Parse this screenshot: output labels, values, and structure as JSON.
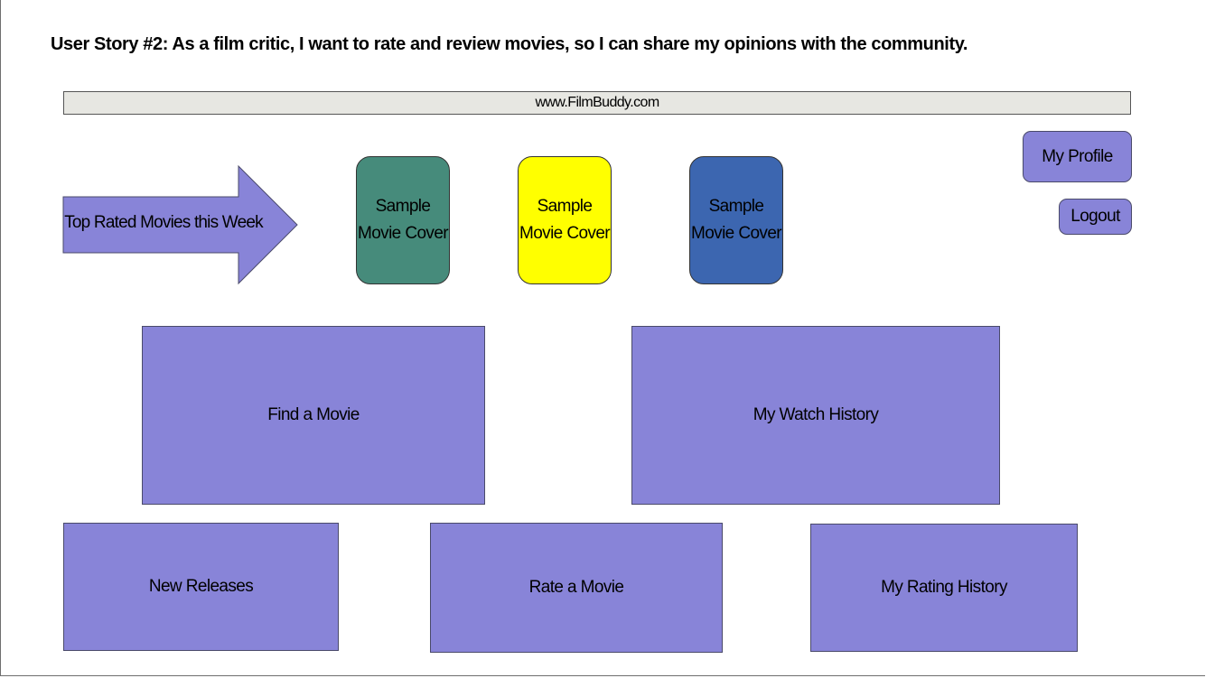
{
  "header": {
    "user_story": "User Story #2: As a film critic, I want to rate and review movies, so I can share my opinions with the community."
  },
  "browser": {
    "url": "www.FilmBuddy.com"
  },
  "account": {
    "profile_label": "My Profile",
    "logout_label": "Logout"
  },
  "top_rated": {
    "banner_label": "Top Rated Movies this Week",
    "covers": [
      {
        "line1": "Sample",
        "line2": "Movie Cover",
        "color": "#468b7b"
      },
      {
        "line1": "Sample",
        "line2": "Movie Cover",
        "color": "#ffff00"
      },
      {
        "line1": "Sample",
        "line2": "Movie Cover",
        "color": "#3c66b0"
      }
    ]
  },
  "tiles": {
    "find_movie": "Find a Movie",
    "watch_history": "My Watch History",
    "new_releases": "New Releases",
    "rate_movie": "Rate a Movie",
    "rating_history": "My Rating History"
  },
  "colors": {
    "tile_fill": "#8884d8",
    "urlbar_fill": "#e7e7e2"
  }
}
